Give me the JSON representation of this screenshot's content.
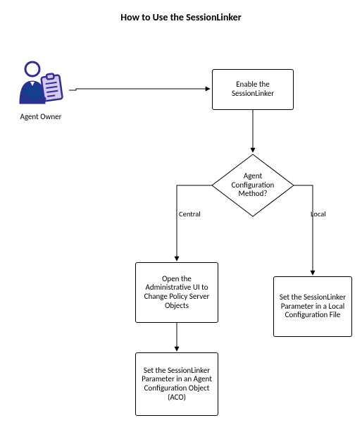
{
  "title": "How to Use the SessionLinker",
  "actor": {
    "label": "Agent Owner"
  },
  "nodes": {
    "enable": "Enable the SessionLinker",
    "decision": "Agent Configuration Method?",
    "open_admin": "Open the Administrative UI to Change Policy Server Objects",
    "set_aco": "Set the SessionLinker Parameter in an Agent Configuration Object (ACO)",
    "set_local": "Set the SessionLinker Parameter in a Local Configuration File"
  },
  "edges": {
    "central": "Central",
    "local": "Local"
  }
}
